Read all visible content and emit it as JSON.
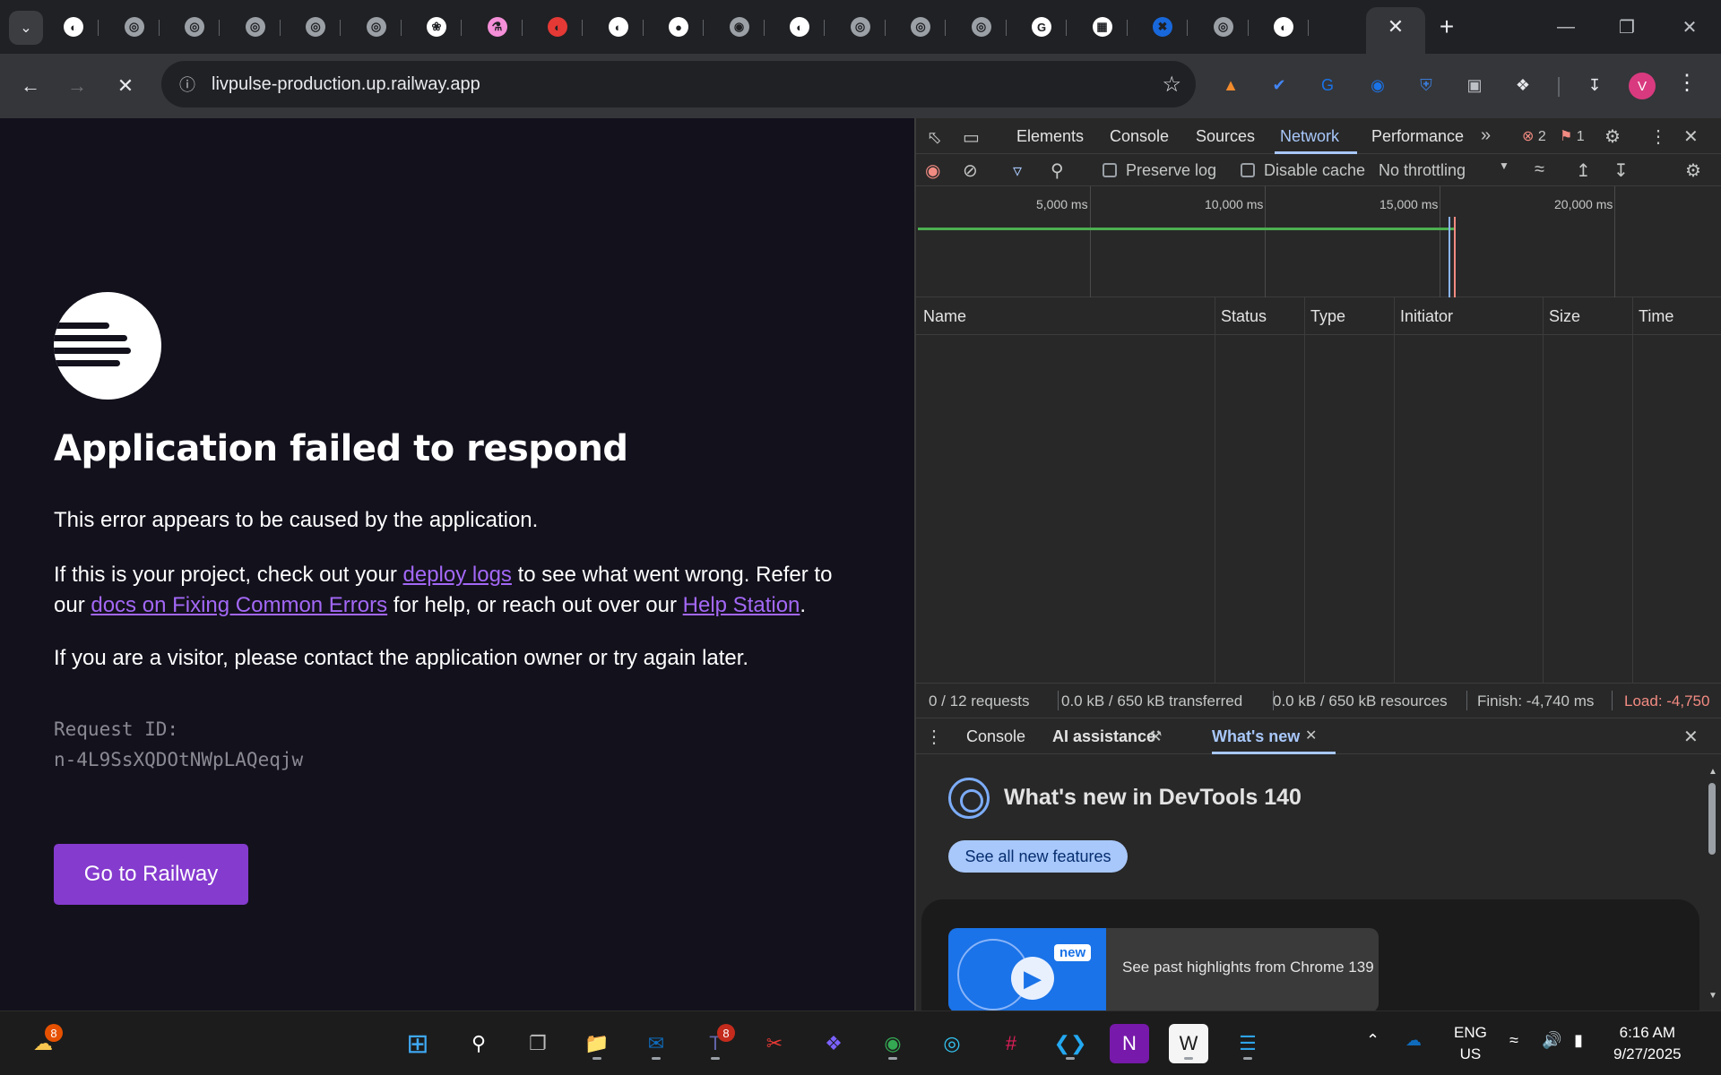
{
  "browser": {
    "tab_search_icon": "chevron-down-icon",
    "tabs": [
      {
        "icon": "railway-icon",
        "color": "#ffffff"
      },
      {
        "icon": "globe-icon",
        "color": "#9aa0a6"
      },
      {
        "icon": "globe-icon",
        "color": "#9aa0a6"
      },
      {
        "icon": "globe-icon",
        "color": "#9aa0a6"
      },
      {
        "icon": "globe-icon",
        "color": "#9aa0a6"
      },
      {
        "icon": "globe-icon",
        "color": "#9aa0a6"
      },
      {
        "icon": "openai-icon",
        "color": "#ffffff"
      },
      {
        "icon": "flask-icon",
        "color": "#f48fd8"
      },
      {
        "icon": "railway-red-icon",
        "color": "#e53935"
      },
      {
        "icon": "railway-icon",
        "color": "#ffffff"
      },
      {
        "icon": "github-icon",
        "color": "#ffffff"
      },
      {
        "icon": "chrome-icon",
        "color": "#9aa0a6"
      },
      {
        "icon": "railway-icon",
        "color": "#ffffff"
      },
      {
        "icon": "globe-icon",
        "color": "#9aa0a6"
      },
      {
        "icon": "globe-icon",
        "color": "#9aa0a6"
      },
      {
        "icon": "globe-icon",
        "color": "#9aa0a6"
      },
      {
        "icon": "google-icon",
        "color": "#ffffff"
      },
      {
        "icon": "apps-icon",
        "color": "#ffffff"
      },
      {
        "icon": "jira-icon",
        "color": "#1868db"
      },
      {
        "icon": "globe-icon",
        "color": "#9aa0a6"
      },
      {
        "icon": "railway-icon",
        "color": "#ffffff"
      }
    ],
    "url": "livpulse-production.up.railway.app",
    "profile_initial": "V"
  },
  "page": {
    "title": "Application failed to respond",
    "p1": "This error appears to be caused by the application.",
    "p2_a": "If this is your project, check out your ",
    "p2_link1": "deploy logs",
    "p2_b": " to see what went wrong. Refer to our ",
    "p2_link2": "docs on Fixing Common Errors",
    "p2_c": " for help, or reach out over our ",
    "p2_link3": "Help Station",
    "p2_d": ".",
    "p3": "If you are a visitor, please contact the application owner or try again later.",
    "request_id_label": "Request ID:",
    "request_id": "n-4L9SsXQDOtNWpLAQeqjw",
    "button": "Go to Railway",
    "accent": "#853bce",
    "link_color": "#a368f6"
  },
  "devtools": {
    "tabs": [
      "Elements",
      "Console",
      "Sources",
      "Network",
      "Performance"
    ],
    "active_tab": "Network",
    "errors": "2",
    "warnings": "1",
    "preserve_log": "Preserve log",
    "disable_cache": "Disable cache",
    "throttling": "No throttling",
    "timeline_labels": [
      "5,000 ms",
      "10,000 ms",
      "15,000 ms",
      "20,000 ms"
    ],
    "columns": [
      "Name",
      "Status",
      "Type",
      "Initiator",
      "Size",
      "Time"
    ],
    "status": {
      "requests": "0 / 12 requests",
      "transferred": "0.0 kB / 650 kB transferred",
      "resources": "0.0 kB / 650 kB resources",
      "finish": "Finish: -4,740 ms",
      "load": "Load: -4,750"
    },
    "drawer_tabs": [
      "Console",
      "AI assistance",
      "What's new"
    ],
    "whats_new_title": "What's new in DevTools 140",
    "see_all": "See all new features",
    "card_new": "new",
    "card_text": "See past highlights from Chrome 139"
  },
  "taskbar": {
    "weather_badge": "8",
    "teams_badge": "8",
    "lang_top": "ENG",
    "lang_bottom": "US",
    "time": "6:16 AM",
    "date": "9/27/2025"
  }
}
